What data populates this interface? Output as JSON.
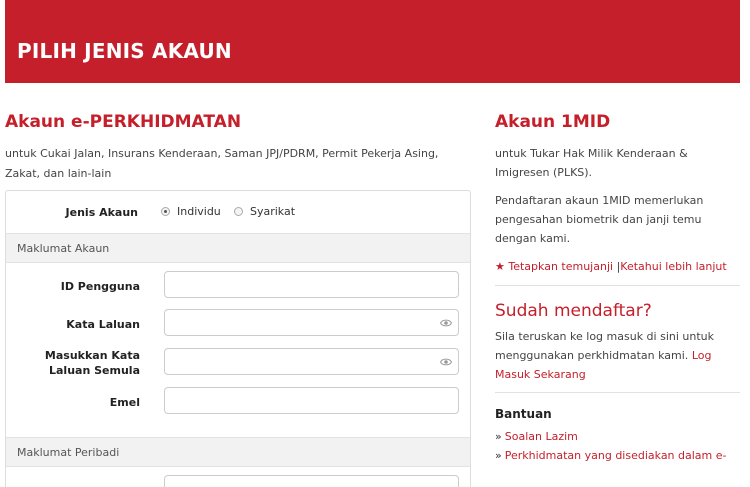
{
  "header": {
    "title": "PILIH JENIS AKAUN"
  },
  "eperkhidmatan": {
    "title": "Akaun e-PERKHIDMATAN",
    "description": "untuk Cukai Jalan, Insurans Kenderaan, Saman JPJ/PDRM, Permit Pekerja Asing, Zakat, dan lain-lain",
    "form": {
      "account_type_label": "Jenis Akaun",
      "account_types": [
        "Individu",
        "Syarikat"
      ],
      "selected_account_type": "Individu",
      "section_account": "Maklumat Akaun",
      "fields": {
        "user_id": "ID Pengguna",
        "password": "Kata Laluan",
        "password_confirm": "Masukkan Kata Laluan Semula",
        "email": "Emel"
      },
      "section_personal": "Maklumat Peribadi"
    }
  },
  "akaun1mid": {
    "title": "Akaun 1MID",
    "description": "untuk Tukar Hak Milik Kenderaan & Imigresen (PLKS).",
    "note": "Pendaftaran akaun 1MID memerlukan pengesahan biometrik dan janji temu dengan kami.",
    "link_appointment": "Tetapkan temujanji",
    "separator": "|",
    "link_learn_more": "Ketahui lebih lanjut"
  },
  "registered": {
    "title": "Sudah mendaftar?",
    "text": "Sila teruskan ke log masuk di sini untuk menggunakan perkhidmatan kami.",
    "login_link": "Log Masuk Sekarang"
  },
  "help": {
    "title": "Bantuan",
    "links": [
      "Soalan Lazim",
      "Perkhidmatan yang disediakan dalam e-"
    ]
  },
  "colors": {
    "brand_red": "#c41f2a"
  }
}
